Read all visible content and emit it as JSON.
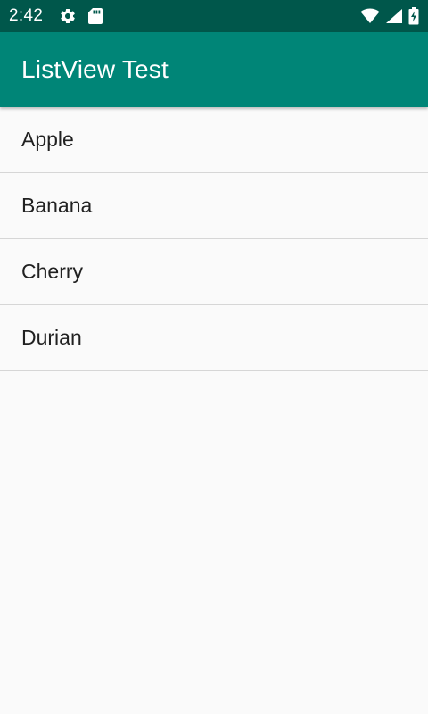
{
  "status_bar": {
    "time": "2:42",
    "left_icons": [
      "settings-icon",
      "sd-card-icon"
    ],
    "right_icons": [
      "wifi-icon",
      "cell-signal-icon",
      "battery-charging-icon"
    ],
    "background": "#00574b"
  },
  "app_bar": {
    "title": "ListView Test",
    "background": "#008577"
  },
  "list": {
    "items": [
      {
        "label": "Apple"
      },
      {
        "label": "Banana"
      },
      {
        "label": "Cherry"
      },
      {
        "label": "Durian"
      }
    ]
  }
}
